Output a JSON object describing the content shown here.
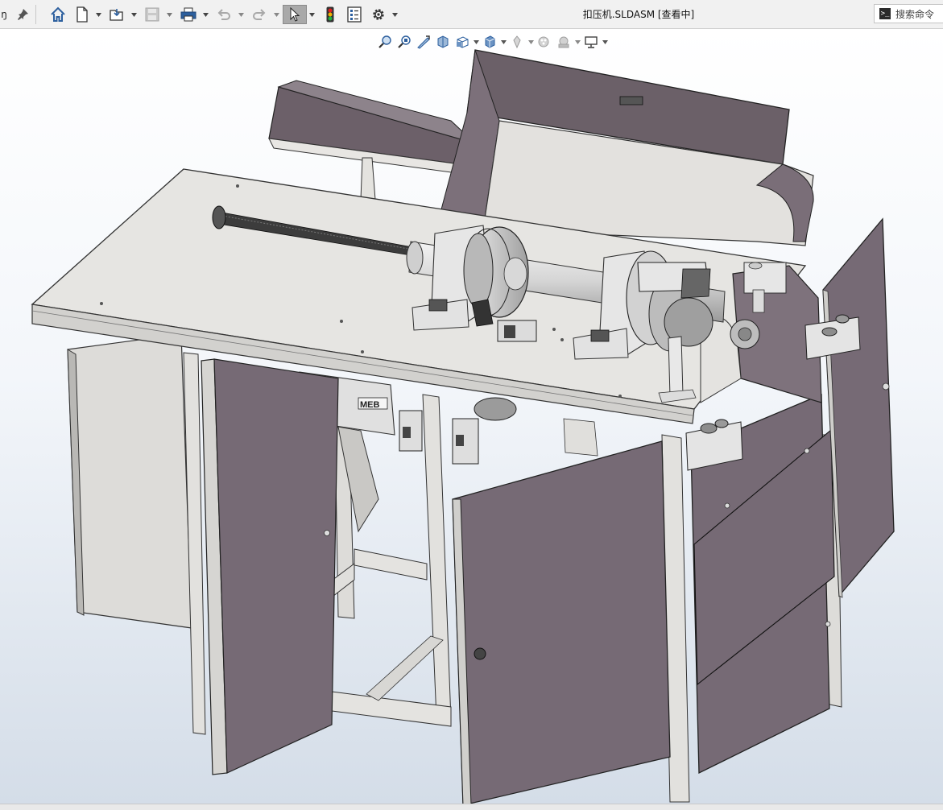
{
  "window": {
    "title": "扣压机.SLDASM [查看中]",
    "left_cut_label": "ŋ"
  },
  "toolbar": {
    "buttons": [
      {
        "name": "pin-icon"
      },
      {
        "name": "home-icon"
      },
      {
        "name": "new-document-icon"
      },
      {
        "name": "open-folder-icon"
      },
      {
        "name": "save-icon"
      },
      {
        "name": "print-icon"
      },
      {
        "name": "undo-icon"
      },
      {
        "name": "redo-icon"
      },
      {
        "name": "select-arrow-icon"
      },
      {
        "name": "rebuild-traffic-light-icon"
      },
      {
        "name": "file-properties-icon"
      },
      {
        "name": "options-gear-icon"
      }
    ]
  },
  "search": {
    "label": "搜索命令",
    "glyph": ">_"
  },
  "heads_up_toolbar": [
    "zoom-to-fit-icon",
    "zoom-to-area-icon",
    "previous-view-icon",
    "section-view-icon",
    "view-orientation-icon",
    "display-style-icon",
    "hide-show-items-icon",
    "edit-appearance-icon",
    "apply-scene-icon",
    "view-settings-icon"
  ],
  "model": {
    "part_label": "MEB",
    "colors": {
      "panel": "#766a75",
      "frame": "#e3e2df",
      "table_top": "#e6e5e2",
      "edge": "#2a2a2a"
    }
  }
}
